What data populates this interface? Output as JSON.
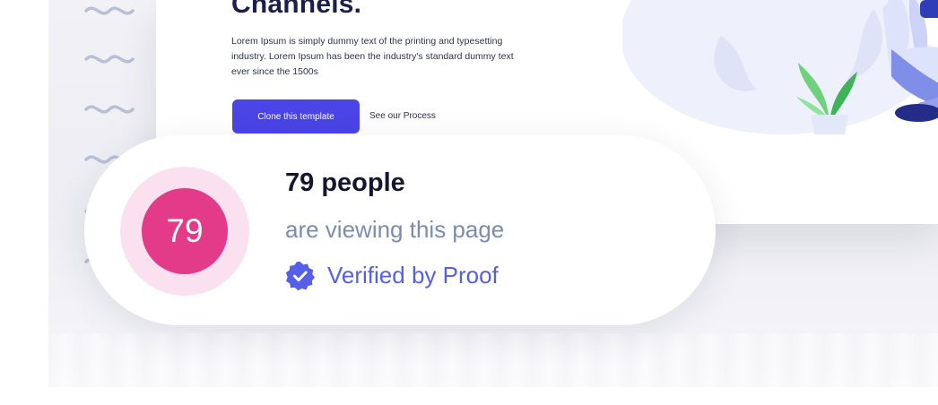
{
  "website": {
    "hero_title": "Channels.",
    "hero_text": "Lorem Ipsum is simply dummy text of the printing and typesetting industry. Lorem Ipsum has been the industry's standard dummy text ever since the 1500s",
    "primary_button": "Clone this template",
    "secondary_link": "See our Process"
  },
  "notification": {
    "count_badge": "79",
    "count_title": "79 people",
    "subtitle": "are viewing this page",
    "verified_label": "Verified by Proof",
    "icon": "verified-check-icon"
  },
  "colors": {
    "badge_pink": "#e43a8a",
    "ring_pink": "#fbe1ef",
    "subtitle": "#7d8bb3",
    "verified_blue": "#5560e6",
    "button_blue": "#4b44e6"
  }
}
